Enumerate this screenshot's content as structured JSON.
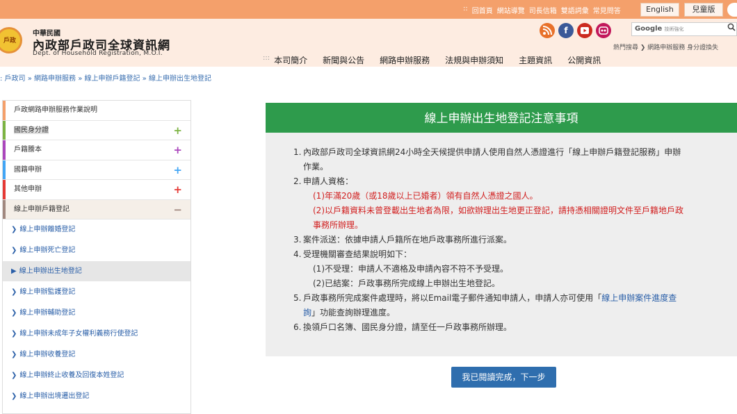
{
  "topbar": {
    "links": [
      "回首頁",
      "網站導覽",
      "司長信箱",
      "雙語詞彙",
      "常見問答"
    ],
    "separator": "::",
    "lang_en": "English",
    "lang_kid": "兒童版"
  },
  "header": {
    "emblem_text": "戶政",
    "org_line1": "中華民國",
    "org_line2": "內政部戶政司全球資訊網",
    "org_line3": "Dept. of Household Registration, M.O.I.",
    "search_brand": "Google",
    "search_sub": "技術強化",
    "hot_search": "熱門搜尋 ❯ 網路申辦服務  身分證換失"
  },
  "social": {
    "rss": "RSS",
    "facebook": "f",
    "youtube": "You",
    "flickr": "••"
  },
  "mainnav": {
    "bullet": ":::",
    "items": [
      "本司簡介",
      "新聞與公告",
      "網路申辦服務",
      "法規與申辦須知",
      "主題資訊",
      "公開資訊"
    ]
  },
  "breadcrumb": ": 戶政司 » 網路申辦服務 » 線上申辦戶籍登記 » 線上申辦出生地登記",
  "sidebar": {
    "categories": [
      {
        "label": "戶政網路申辦服務作業說明",
        "color": "#f4a06b",
        "sign": ""
      },
      {
        "label": "國民身分證",
        "color": "#7cb342",
        "sign": "+"
      },
      {
        "label": "戶籍謄本",
        "color": "#ab47bc",
        "sign": "+"
      },
      {
        "label": "國籍申辦",
        "color": "#42a5f5",
        "sign": "+"
      },
      {
        "label": "其他申辦",
        "color": "#e53935",
        "sign": "+"
      },
      {
        "label": "線上申辦戶籍登記",
        "color": "#a1887f",
        "sign": "−"
      }
    ],
    "subitems": [
      "線上申辦離婚登記",
      "線上申辦死亡登記",
      "線上申辦出生地登記",
      "線上申辦監護登記",
      "線上申辦輔助登記",
      "線上申辦未成年子女權利義務行使登記",
      "線上申辦收養登記",
      "線上申辦終止收養及回復本姓登記",
      "線上申辦出境遷出登記"
    ]
  },
  "notice": {
    "title": "線上申辦出生地登記注意事項",
    "item1_num": "1.",
    "item1": "內政部戶政司全球資訊網24小時全天候提供申請人使用自然人憑證進行「線上申辦戶籍登記服務」申辦",
    "item1_cont": "作業。",
    "item2_num": "2.",
    "item2": "申請人資格：",
    "item2_a": "(1)年滿20歲（或18歲以上已婚者）領有自然人憑證之國人。",
    "item2_b": "(2)以戶籍資料未曾登載出生地者為限，如欲辦理出生地更正登記，請持憑相關證明文件至戶籍地戶政",
    "item2_b_cont": "事務所辦理。",
    "item3_num": "3.",
    "item3": "案件派送：依據申請人戶籍所在地戶政事務所進行派案。",
    "item4_num": "4.",
    "item4": "受理機關審查結果說明如下：",
    "item4_a": "(1)不受理：申請人不適格及申請內容不符不予受理。",
    "item4_b": "(2)已結案：戶政事務所完成線上申辦出生地登記。",
    "item5_num": "5.",
    "item5_pre": "戶政事務所完成案件處理時，將以Email電子郵件通知申請人，申請人亦可使用「",
    "item5_link": "線上申辦案件進度查",
    "item5_link2": "詢",
    "item5_post": "」功能查詢辦理進度。",
    "item6_num": "6.",
    "item6": "換領戶口名簿、國民身分證，請至任一戶政事務所辦理。",
    "next_button": "我已閱讀完成，下一步"
  }
}
